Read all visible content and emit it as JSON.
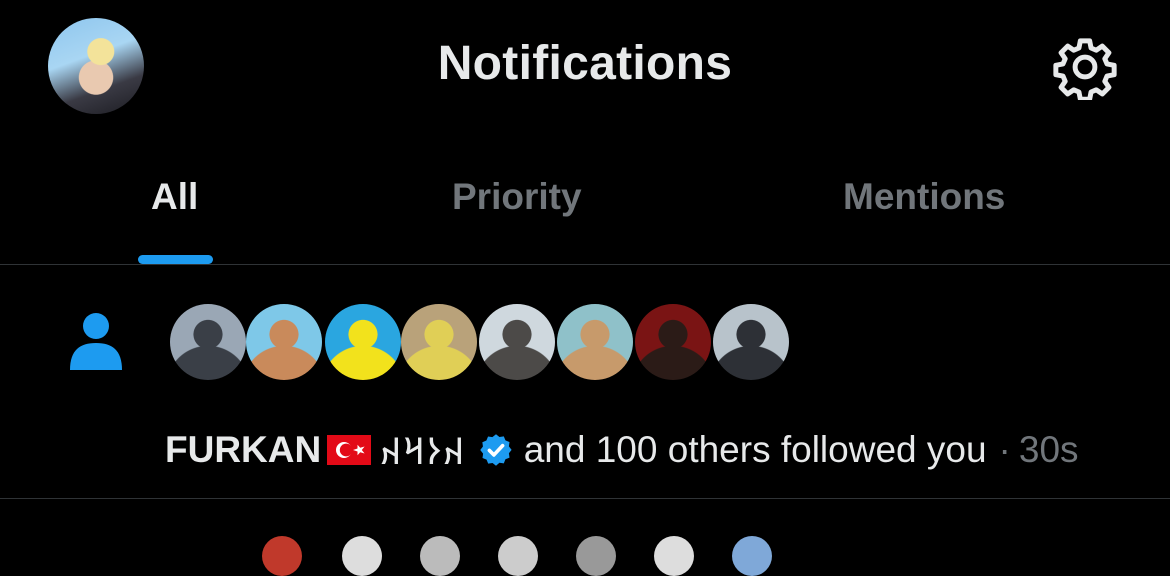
{
  "header": {
    "title": "Notifications"
  },
  "tabs": [
    {
      "label": "All",
      "active": true
    },
    {
      "label": "Priority",
      "active": false
    },
    {
      "label": "Mentions",
      "active": false
    }
  ],
  "notification": {
    "type_icon": "person-icon",
    "follower_avatars": [
      {
        "colors": [
          "#9aa7b5",
          "#3a3f47"
        ]
      },
      {
        "colors": [
          "#7ec8e8",
          "#c98a5b"
        ]
      },
      {
        "colors": [
          "#2aa6e0",
          "#f2e21c"
        ]
      },
      {
        "colors": [
          "#b9a27a",
          "#e0cf56"
        ]
      },
      {
        "colors": [
          "#cfd8de",
          "#4c4a48"
        ]
      },
      {
        "colors": [
          "#8fc1c9",
          "#c79a6b"
        ]
      },
      {
        "colors": [
          "#7a1414",
          "#2b1b17"
        ]
      },
      {
        "colors": [
          "#b8c3cb",
          "#2d3036"
        ]
      }
    ],
    "name": "FURKAN",
    "flag": "🇹🇷",
    "name_suffix": "𐰴𐰆𐰺𐰴",
    "verified": true,
    "text": "and 100 others followed you",
    "separator": "·",
    "time": "30s"
  },
  "colors": {
    "accent": "#1d9bf0",
    "muted": "#71767b",
    "text": "#e7e9ea",
    "background": "#000000"
  }
}
